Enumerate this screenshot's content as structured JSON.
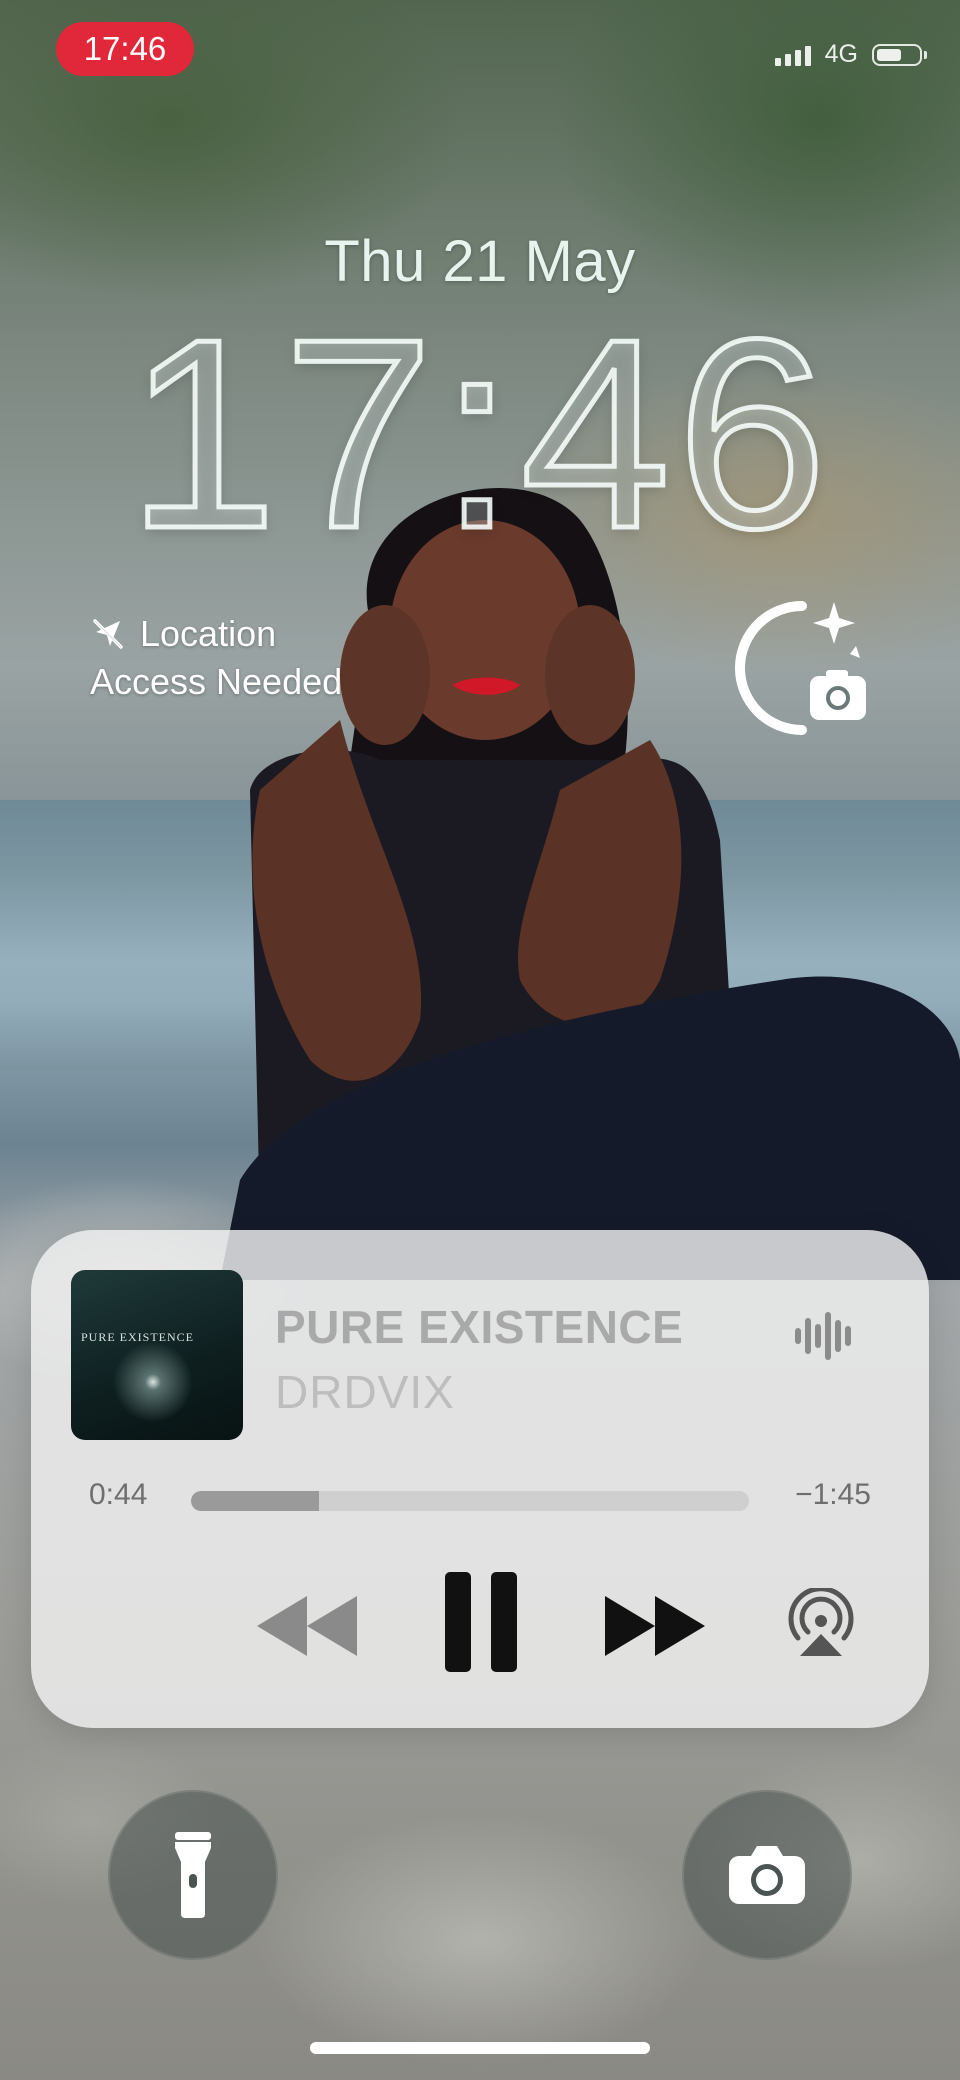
{
  "status_bar": {
    "time": "17:46",
    "network": "4G",
    "signal_bars": 4,
    "battery_icon": "battery-icon"
  },
  "lock_screen": {
    "date": "Thu 21 May",
    "time": "17:46"
  },
  "widgets": {
    "location": {
      "line1": "Location",
      "line2": "Access Needed",
      "icon": "location-slash-icon"
    },
    "camera_widget": {
      "icon": "camera-sparkle-icon"
    }
  },
  "now_playing": {
    "album_art_text": "PURE EXISTENCE",
    "title": "PURE EXISTENCE",
    "artist": "DRDVIX",
    "elapsed": "0:44",
    "remaining": "−1:45",
    "progress_fraction": 0.23,
    "controls": [
      "rewind",
      "pause",
      "fast-forward",
      "airplay"
    ]
  },
  "quick_actions": {
    "left": {
      "icon": "flashlight-icon"
    },
    "right": {
      "icon": "camera-icon"
    }
  },
  "colors": {
    "status_pill": "#e0283a",
    "player_bg": "#f0f0f0",
    "control_dark": "#111111",
    "control_disabled": "#8a8a8a"
  }
}
